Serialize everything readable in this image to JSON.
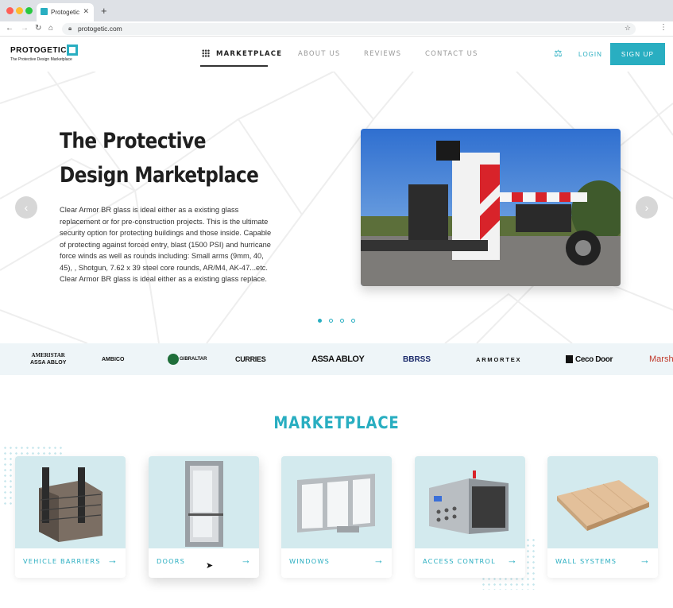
{
  "browser": {
    "tab_title": "Protogetic",
    "tab_close": "✕",
    "new_tab": "+",
    "url": "protogetic.com",
    "icons": [
      "back-arrow-icon",
      "forward-arrow-icon",
      "reload-icon",
      "home-icon",
      "lock-icon",
      "bookmark-star-icon",
      "menu-dots-icon"
    ]
  },
  "header": {
    "logo_name": "PROTOGETIC",
    "logo_tagline": "The Protective Design Marketplace",
    "nav": [
      {
        "label": "MARKETPLACE",
        "active": true
      },
      {
        "label": "ABOUT US"
      },
      {
        "label": "REVIEWS"
      },
      {
        "label": "CONTACT US"
      }
    ],
    "login": "LOGIN",
    "signup": "SIGN UP"
  },
  "hero": {
    "title_line1": "The Protective",
    "title_line2": "Design Marketplace",
    "description": "Clear Armor BR glass is ideal either as a existing glass replacement or for pre-construction projects. This is the ultimate security option for protecting buildings and those inside. Capable of protecting against forced entry, blast (1500 PSI) and hurricane force winds as well as rounds including: Small arms (9mm, 40, 45), , Shotgun, 7.62 x 39 steel core rounds, AR/M4, AK-47...etc. Clear Armor BR glass is ideal either as a existing glass replace.",
    "prev": "‹",
    "next": "›",
    "slide_count": 4,
    "active_slide": 1
  },
  "brands": [
    {
      "name": "AMERISTAR",
      "sub": "ASSA ABLOY"
    },
    {
      "name": "AMBICO"
    },
    {
      "name": "GIBRALTAR"
    },
    {
      "name": "CURRIES"
    },
    {
      "name": "ASSA ABLOY"
    },
    {
      "name": "BBRSS"
    },
    {
      "name": "ARMORTEX"
    },
    {
      "name": "Ceco Door"
    },
    {
      "name": "Marsh"
    }
  ],
  "marketplace": {
    "title": "MARKETPLACE",
    "cards": [
      {
        "label": "VEHICLE BARRIERS"
      },
      {
        "label": "DOORS"
      },
      {
        "label": "WINDOWS"
      },
      {
        "label": "ACCESS CONTROL"
      },
      {
        "label": "WALL SYSTEMS"
      }
    ],
    "arrow": "→"
  },
  "colors": {
    "accent": "#29aec1",
    "text": "#1f1f1f",
    "brand_strip": "#eef5f8"
  }
}
